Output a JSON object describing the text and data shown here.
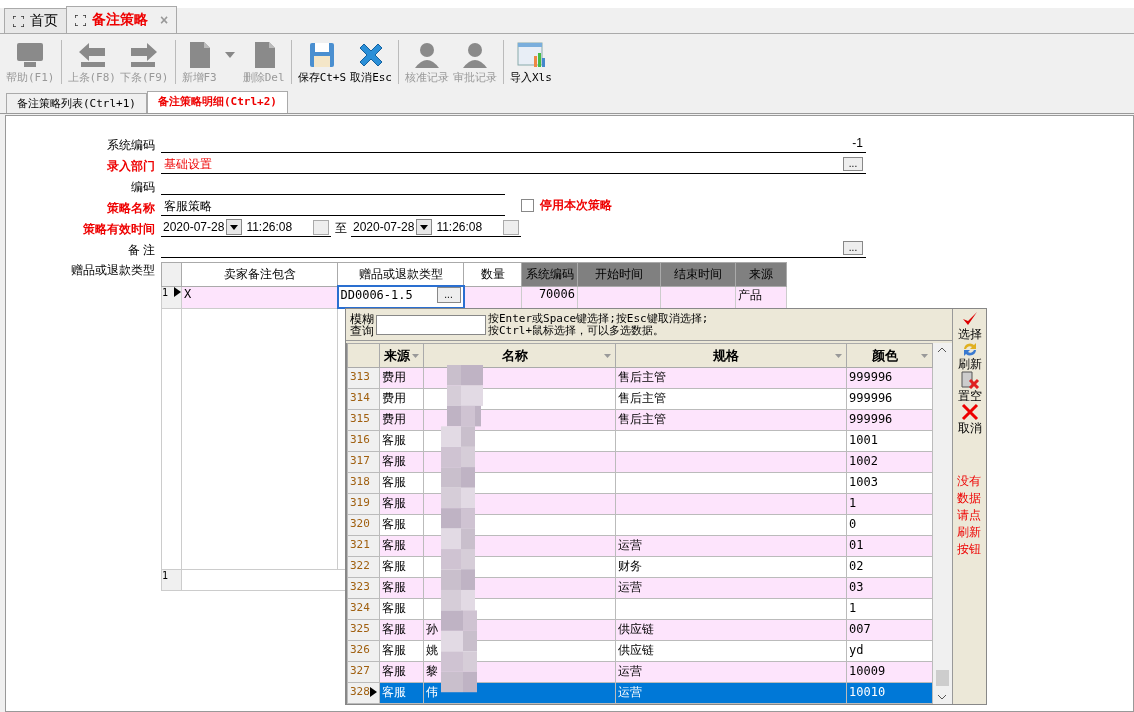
{
  "tabs": [
    {
      "label": "首页",
      "selected": false
    },
    {
      "label": "备注策略",
      "selected": true,
      "close": "×"
    }
  ],
  "toolbar": [
    {
      "label": "帮助(F1)",
      "disabled": true
    },
    {
      "label": "上条(F8)",
      "disabled": true
    },
    {
      "label": "下条(F9)",
      "disabled": true
    },
    {
      "label": "新增F3",
      "disabled": true
    },
    {
      "label": "删除Del",
      "disabled": true
    },
    {
      "label": "保存Ct+S",
      "disabled": false
    },
    {
      "label": "取消Esc",
      "disabled": false
    },
    {
      "label": "核准记录",
      "disabled": true
    },
    {
      "label": "审批记录",
      "disabled": true
    },
    {
      "label": "导入Xls",
      "disabled": false
    }
  ],
  "subtabs": [
    {
      "label": "备注策略列表(Ctrl+1)",
      "selected": false
    },
    {
      "label": "备注策略明细(Ctrl+2)",
      "selected": true
    }
  ],
  "form": [
    {
      "label": "系统编码",
      "required": false,
      "kind": "number",
      "value": "-1"
    },
    {
      "label": "录入部门",
      "required": true,
      "kind": "lookup",
      "value": "基础设置",
      "button": "..."
    },
    {
      "label": "编码",
      "required": false,
      "kind": "text"
    },
    {
      "label": "策略名称",
      "required": true,
      "kind": "text",
      "value": "客服策略",
      "checkbox": {
        "label": "停用本次策略",
        "checked": false
      }
    },
    {
      "label": "策略有效时间",
      "required": true,
      "kind": "daterange",
      "from_date": "2020-07-28",
      "from_time": "11:26:08",
      "to_label": "至",
      "to_date": "2020-07-28",
      "to_time": "11:26:08"
    },
    {
      "label": "备 注",
      "required": false,
      "kind": "lookup",
      "button": "..."
    },
    {
      "label": "赠品或退款类型",
      "required": false,
      "kind": "grid"
    }
  ],
  "grid": {
    "columns": [
      {
        "label": "卖家备注包含",
        "readonly": false
      },
      {
        "label": "赠品或退款类型",
        "readonly": false
      },
      {
        "label": "数量",
        "readonly": false
      },
      {
        "label": "系统编码",
        "readonly": true
      },
      {
        "label": "开始时间",
        "readonly": true
      },
      {
        "label": "结束时间",
        "readonly": true
      },
      {
        "label": "来源",
        "readonly": true
      }
    ],
    "rows": [
      {
        "no": "1",
        "current": true,
        "cells": [
          {
            "text": "X",
            "editing": false
          },
          {
            "text": "DD0006-1.5",
            "editing": true,
            "button": "..."
          },
          {
            "text": "",
            "editing": false
          },
          {
            "text": "70006",
            "editing": false
          },
          {
            "text": "",
            "editing": false
          },
          {
            "text": "",
            "editing": false
          },
          {
            "text": "产品",
            "editing": false
          }
        ]
      }
    ],
    "footer": "1"
  },
  "popup": {
    "search_label": "模糊查询",
    "hint_lines": [
      "按Enter或Space键选择;按Esc键取消选择;",
      "按Ctrl+鼠标选择，可以多选数据。"
    ],
    "columns": [
      {
        "label": "来源"
      },
      {
        "label": "名称"
      },
      {
        "label": "规格"
      },
      {
        "label": "颜色"
      }
    ],
    "rows": [
      {
        "no": "313",
        "selected": false,
        "cells": [
          "费用",
          "",
          "售后主管",
          "999996"
        ]
      },
      {
        "no": "314",
        "selected": false,
        "cells": [
          "费用",
          "",
          "售后主管",
          "999996"
        ]
      },
      {
        "no": "315",
        "selected": false,
        "cells": [
          "费用",
          "",
          "售后主管",
          "999996"
        ]
      },
      {
        "no": "316",
        "selected": false,
        "cells": [
          "客服",
          "",
          "",
          "1001"
        ]
      },
      {
        "no": "317",
        "selected": false,
        "cells": [
          "客服",
          "",
          "",
          "1002"
        ]
      },
      {
        "no": "318",
        "selected": false,
        "cells": [
          "客服",
          "",
          "",
          "1003"
        ]
      },
      {
        "no": "319",
        "selected": false,
        "cells": [
          "客服",
          "",
          "",
          "1"
        ]
      },
      {
        "no": "320",
        "selected": false,
        "cells": [
          "客服",
          "",
          "",
          "0"
        ]
      },
      {
        "no": "321",
        "selected": false,
        "cells": [
          "客服",
          "",
          "运营",
          "01"
        ]
      },
      {
        "no": "322",
        "selected": false,
        "cells": [
          "客服",
          "",
          "财务",
          "02"
        ]
      },
      {
        "no": "323",
        "selected": false,
        "cells": [
          "客服",
          "",
          "运营",
          "03"
        ]
      },
      {
        "no": "324",
        "selected": false,
        "cells": [
          "客服",
          "",
          "",
          "1"
        ]
      },
      {
        "no": "325",
        "selected": false,
        "cells": [
          "客服",
          "孙",
          "供应链",
          "007"
        ]
      },
      {
        "no": "326",
        "selected": false,
        "cells": [
          "客服",
          "姚",
          "供应链",
          "yd"
        ]
      },
      {
        "no": "327",
        "selected": false,
        "cells": [
          "客服",
          "黎",
          "运营",
          "10009"
        ]
      },
      {
        "no": "328",
        "selected": true,
        "cells": [
          "客服",
          "伟",
          "运营",
          "10010"
        ]
      }
    ],
    "actions": [
      {
        "label": "选择"
      },
      {
        "label": "刷新"
      },
      {
        "label": "置空"
      },
      {
        "label": "取消"
      }
    ],
    "notice": "没有数据请点刷新按钮"
  }
}
